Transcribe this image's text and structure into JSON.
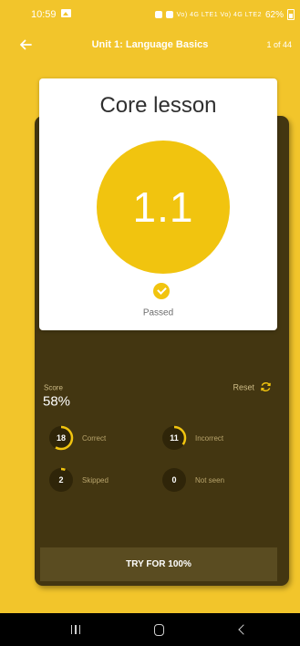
{
  "status_bar": {
    "time": "10:59",
    "battery": "62%",
    "signal_text": "Vo) 4G LTE1 Vo) 4G LTE2"
  },
  "app_bar": {
    "title": "Unit 1: Language Basics",
    "page_count": "1 of 44"
  },
  "lesson": {
    "title": "Core lesson",
    "number": "1.1",
    "status": "Passed"
  },
  "score": {
    "label": "Score",
    "value": "58%",
    "reset_label": "Reset"
  },
  "stats": [
    {
      "label": "Correct",
      "count": "18",
      "progress": 0.58
    },
    {
      "label": "Incorrect",
      "count": "11",
      "progress": 0.35
    },
    {
      "label": "Skipped",
      "count": "2",
      "progress": 0.06
    },
    {
      "label": "Not seen",
      "count": "0",
      "progress": 0
    }
  ],
  "try_button": {
    "label": "TRY FOR 100%"
  },
  "colors": {
    "background": "#f2c52b",
    "card": "#433611",
    "accent": "#f1c40f",
    "button": "#5a4c21"
  },
  "icons": {
    "back": "arrow-left-icon",
    "reset": "refresh-icon",
    "pass": "check-circle-icon",
    "nav_recents": "recents-icon",
    "nav_home": "home-icon",
    "nav_back": "back-icon"
  }
}
